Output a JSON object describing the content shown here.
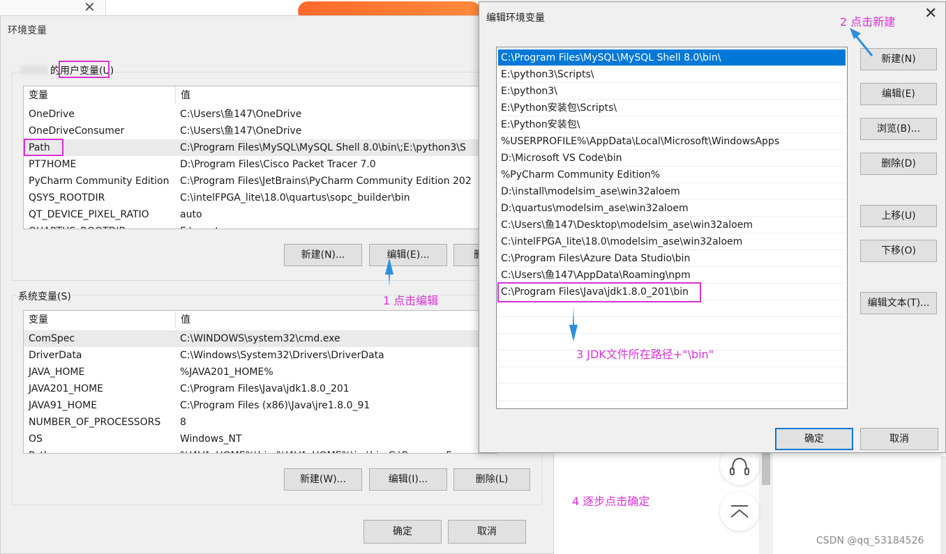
{
  "env_dialog": {
    "title": "环境变量",
    "user_group_label": "的用户变量(U)",
    "system_group_label": "系统变量(S)",
    "columns": {
      "name": "变量",
      "value": "值"
    },
    "user_vars": [
      {
        "name": "OneDrive",
        "value": "C:\\Users\\鱼147\\OneDrive"
      },
      {
        "name": "OneDriveConsumer",
        "value": "C:\\Users\\鱼147\\OneDrive"
      },
      {
        "name": "Path",
        "value": "C:\\Program Files\\MySQL\\MySQL Shell 8.0\\bin\\;E:\\python3\\S"
      },
      {
        "name": "PT7HOME",
        "value": "D:\\Program Files\\Cisco Packet Tracer 7.0"
      },
      {
        "name": "PyCharm Community Edition",
        "value": "C:\\Program Files\\JetBrains\\PyCharm Community Edition 202"
      },
      {
        "name": "QSYS_ROOTDIR",
        "value": "C:\\intelFPGA_lite\\18.0\\quartus\\sopc_builder\\bin"
      },
      {
        "name": "QT_DEVICE_PIXEL_RATIO",
        "value": "auto"
      },
      {
        "name": "QUARTUS_ROOTDIR",
        "value": "E:\\quart"
      }
    ],
    "user_buttons": {
      "new": "新建(N)...",
      "edit": "编辑(E)...",
      "delete": "删"
    },
    "system_vars": [
      {
        "name": "ComSpec",
        "value": "C:\\WINDOWS\\system32\\cmd.exe"
      },
      {
        "name": "DriverData",
        "value": "C:\\Windows\\System32\\Drivers\\DriverData"
      },
      {
        "name": "JAVA_HOME",
        "value": "%JAVA201_HOME%"
      },
      {
        "name": "JAVA201_HOME",
        "value": "C:\\Program Files\\Java\\jdk1.8.0_201"
      },
      {
        "name": "JAVA91_HOME",
        "value": "C:\\Program Files (x86)\\Java\\jre1.8.0_91"
      },
      {
        "name": "NUMBER_OF_PROCESSORS",
        "value": "8"
      },
      {
        "name": "OS",
        "value": "Windows_NT"
      },
      {
        "name": "Path",
        "value": "%JAVA_HOME%\\bin;%JAVA_HOME%\\jre\\bin;C:\\Program F"
      }
    ],
    "system_buttons": {
      "new": "新建(W)...",
      "edit": "编辑(I)...",
      "delete": "删除(L)"
    },
    "ok": "确定",
    "cancel": "取消"
  },
  "edit_dialog": {
    "title": "编辑环境变量",
    "paths": [
      "C:\\Program Files\\MySQL\\MySQL Shell 8.0\\bin\\",
      "E:\\python3\\Scripts\\",
      "E:\\python3\\",
      "E:\\Python安装包\\Scripts\\",
      "E:\\Python安装包\\",
      "%USERPROFILE%\\AppData\\Local\\Microsoft\\WindowsApps",
      "D:\\Microsoft VS Code\\bin",
      "%PyCharm Community Edition%",
      "D:\\install\\modelsim_ase\\win32aloem",
      "D:\\quartus\\modelsim_ase\\win32aloem",
      "C:\\Users\\鱼147\\Desktop\\modelsim_ase\\win32aloem",
      "C:\\intelFPGA_lite\\18.0\\modelsim_ase\\win32aloem",
      "C:\\Program Files\\Azure Data Studio\\bin",
      "C:\\Users\\鱼147\\AppData\\Roaming\\npm",
      "C:\\Program Files\\Java\\jdk1.8.0_201\\bin"
    ],
    "selected_index": 0,
    "buttons": {
      "new": "新建(N)",
      "edit": "编辑(E)",
      "browse": "浏览(B)...",
      "delete": "删除(D)",
      "move_up": "上移(U)",
      "move_down": "下移(O)",
      "edit_text": "编辑文本(T)..."
    },
    "ok": "确定",
    "cancel": "取消"
  },
  "annotations": {
    "step1": "1 点击编辑",
    "step2": "2 点击新建",
    "step3": "3 JDK文件所在路径+\"\\bin\"",
    "step4": "4 逐步点击确定",
    "color": "#d633d6",
    "arrow_color": "#2b8fe0"
  },
  "watermark": "CSDN @qq_53184526"
}
